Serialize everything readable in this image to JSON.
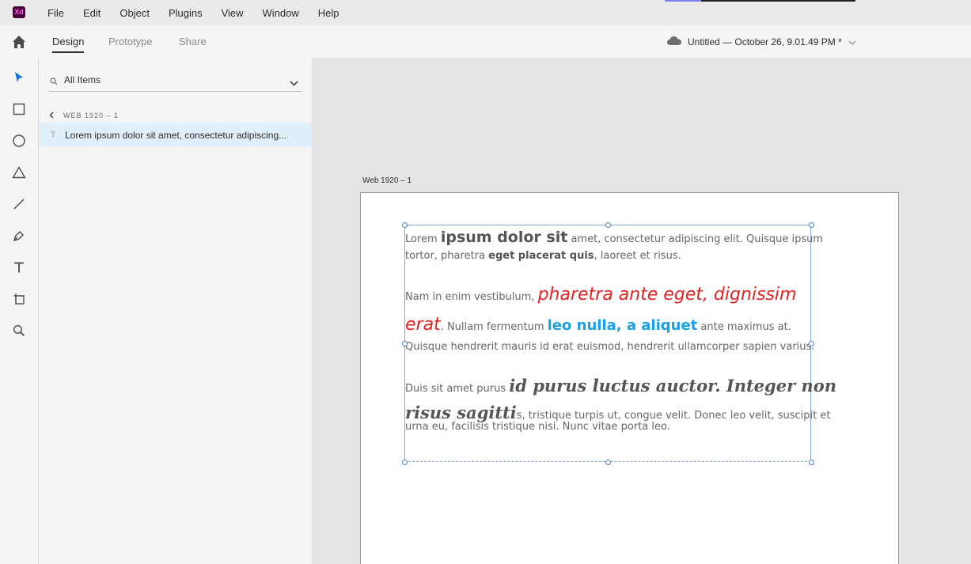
{
  "app": {
    "logo_text": "Xd",
    "menu": [
      "File",
      "Edit",
      "Object",
      "Plugins",
      "View",
      "Window",
      "Help"
    ]
  },
  "tabs": [
    "Design",
    "Prototype",
    "Share"
  ],
  "document": {
    "title": "Untitled — October 26, 9.01.49 PM *"
  },
  "layers": {
    "search_placeholder": "All Items",
    "breadcrumb": "WEB 1920 – 1",
    "item_type_glyph": "T",
    "item_label": "Lorem ipsum dolor sit amet, consectetur adipiscing..."
  },
  "artboard": {
    "label": "Web 1920 – 1"
  },
  "text": {
    "p1": {
      "l1a": "Lorem ",
      "l1b": "ipsum dolor sit",
      "l1c": " amet, consectetur adipiscing elit. Quisque ipsum",
      "l2a": "tortor, pharetra ",
      "l2b": "eget placerat quis",
      "l2c": ", laoreet et risus."
    },
    "p2": {
      "l1a": "Nam in enim vestibulum, ",
      "l1b": "pharetra ante eget, dignissim",
      "l2a": "erat",
      "l2b": ". Nullam fermentum ",
      "l2c": "leo nulla, a aliquet",
      "l2d": " ante maximus at.",
      "l3": "Quisque hendrerit mauris id erat euismod, hendrerit ullamcorper sapien varius."
    },
    "p3": {
      "l1a": "Duis sit amet purus ",
      "l1b": "id purus luctus auctor. Integer non",
      "l2a": "risus sagitti",
      "l2b": "s, tristique turpis ut, congue velit. Donec leo velit, suscipit et",
      "l3": "urna eu, facilisis tristique nisi. Nunc vitae porta leo."
    }
  },
  "colors": {
    "accent": "#1473e6",
    "red_text": "#e32222",
    "blue_text": "#1aa0e6",
    "selection": "#4b82c9"
  }
}
